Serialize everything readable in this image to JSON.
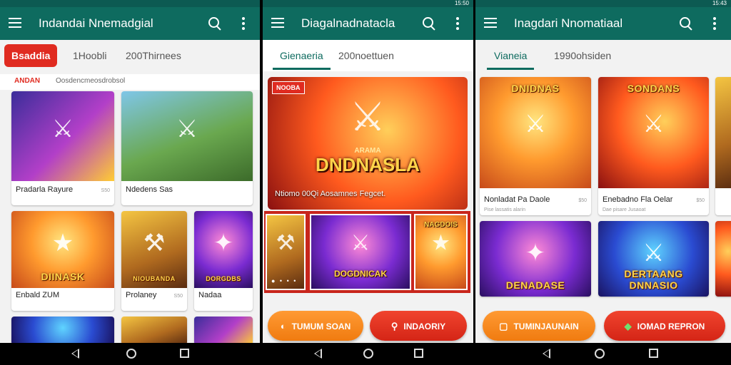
{
  "status": {
    "time_left": "",
    "time_mid": "15:50",
    "time_right": "15:43"
  },
  "screens": [
    {
      "appbar_title": "Indandai Nnemadgial",
      "tabs": [
        "Bsaddia",
        "1Hoobli",
        "200Thirnees"
      ],
      "section_label": "Oosdencmeosdrobsol",
      "section_tag": "ANDAN",
      "cards": [
        {
          "title": "Pradarla Rayure",
          "meta": "",
          "badge": "S50"
        },
        {
          "title": "Ndedens Sas",
          "meta": "",
          "badge": ""
        },
        {
          "title": "Enbald ZUM",
          "meta": "",
          "badge": "",
          "logo": "DIINASK"
        },
        {
          "title": "Prolaney",
          "meta": "",
          "badge": "S50",
          "logo": "NIOUBANDA"
        },
        {
          "title": "Nadaa",
          "meta": "",
          "badge": "",
          "logo": "DORGDBS"
        }
      ]
    },
    {
      "appbar_title": "Diagalnadnatacla",
      "tabs": [
        "Gienaeria",
        "200noettuen"
      ],
      "hero": {
        "badge": "NOOBA",
        "logo": "DNDNASLA",
        "logo_top": "ARAMA",
        "subtitle": "Ntiomo 00Qi Aosamnes Fegcet."
      },
      "strip": [
        {
          "logo": ""
        },
        {
          "logo": "DOGDNICAK"
        },
        {
          "logo": "NAGDOIS"
        }
      ],
      "buttons": [
        "TUMUM SOAN",
        "INDAORIY"
      ]
    },
    {
      "appbar_title": "Inagdari Nnomatiaal",
      "tabs": [
        "Vianeia",
        "1990ohsiden"
      ],
      "cards": [
        {
          "title": "Nonladat Pa Daole",
          "meta": "Pise lassatis alarin",
          "badge": "$50",
          "logo": "DNIDNAS"
        },
        {
          "title": "Enebadno Fla Oelar",
          "meta": "Dae pisare Jusaoat",
          "badge": "$50",
          "logo": "SONDANS"
        },
        {
          "title": "",
          "meta": "",
          "badge": "",
          "logo": "DENADASE"
        },
        {
          "title": "",
          "meta": "",
          "badge": "",
          "logo": "DERTAANG DNNASIO"
        }
      ],
      "buttons": [
        "TUMINJAUNAIN",
        "IOMAD REPRON"
      ]
    }
  ]
}
